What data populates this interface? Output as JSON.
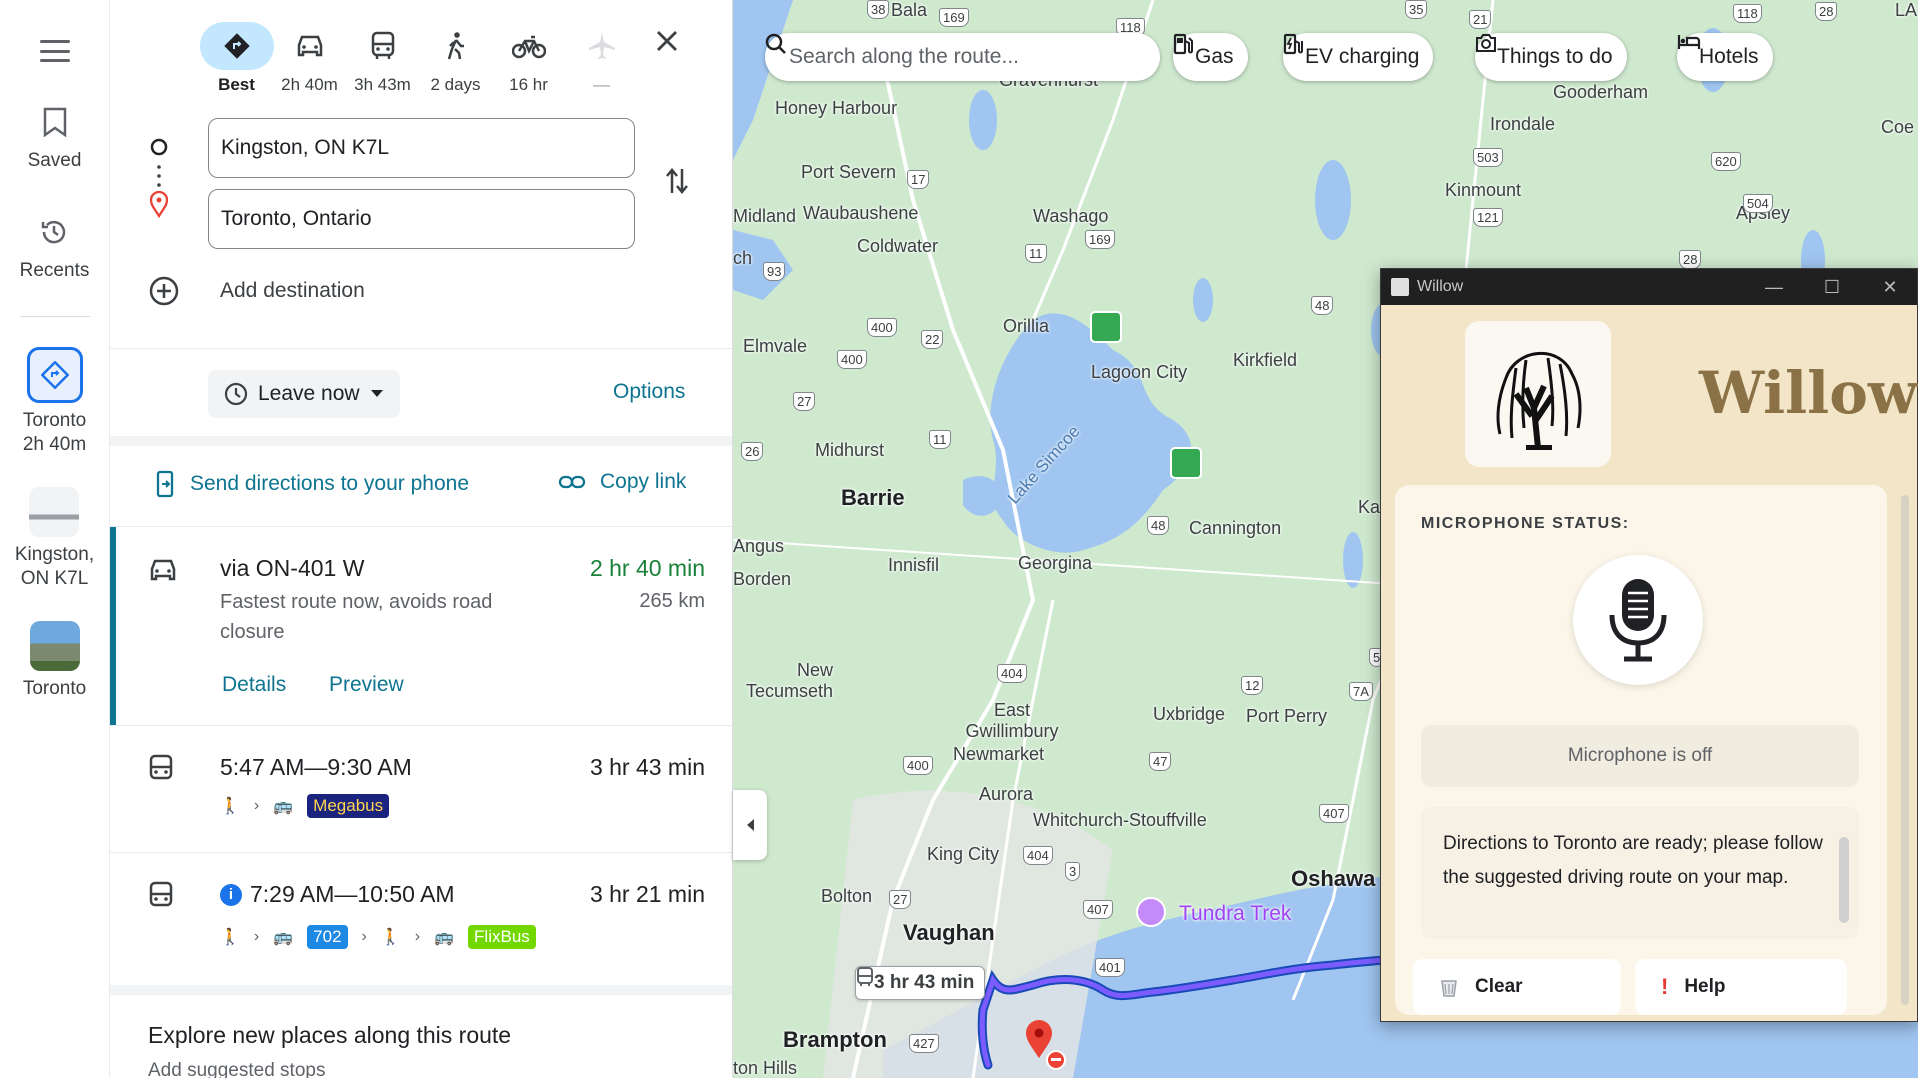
{
  "rail": {
    "saved": "Saved",
    "recents": "Recents",
    "recent_items": [
      {
        "label_line1": "Toronto",
        "label_line2": "2h 40m"
      },
      {
        "label_line1": "Kingston,",
        "label_line2": "ON K7L"
      },
      {
        "label_line1": "Toronto",
        "label_line2": ""
      }
    ]
  },
  "modes": [
    {
      "label": "Best"
    },
    {
      "label": "2h 40m"
    },
    {
      "label": "3h 43m"
    },
    {
      "label": "2 days"
    },
    {
      "label": "16 hr"
    },
    {
      "label": "—"
    }
  ],
  "origin": "Kingston, ON K7L",
  "destination": "Toronto, Ontario",
  "add_destination": "Add destination",
  "leave_now": "Leave now",
  "options": "Options",
  "send_directions": "Send directions to your phone",
  "copy_link": "Copy link",
  "routes": {
    "drive": {
      "title": "via ON-401 W",
      "time": "2 hr 40 min",
      "subtitle": "Fastest route now, avoids road closure",
      "distance": "265 km",
      "details": "Details",
      "preview": "Preview"
    },
    "transit1": {
      "title": "5:47 AM—9:30 AM",
      "time": "3 hr 43 min",
      "badge": "Megabus"
    },
    "transit2": {
      "info": "i",
      "title": "7:29 AM—10:50 AM",
      "time": "3 hr 21 min",
      "badge1": "702",
      "badge2": "FlixBus"
    }
  },
  "explore": {
    "title": "Explore new places along this route",
    "subtitle": "Add suggested stops"
  },
  "map": {
    "search_placeholder": "Search along the route...",
    "chips": [
      "Gas",
      "EV charging",
      "Things to do",
      "Hotels"
    ],
    "route_bubble": "3 hr 43 min",
    "labels": {
      "bala": "Bala",
      "honey_harbour": "Honey Harbour",
      "gravenhurst": "Gravenhurst",
      "gooderham": "Gooderham",
      "irondale": "Irondale",
      "coe_hill": "Coe H",
      "port_severn": "Port Severn",
      "midland": "Midland",
      "waubaushene": "Waubaushene",
      "coldwater": "Coldwater",
      "washago": "Washago",
      "kinmount": "Kinmount",
      "apsley": "Apsley",
      "elmvale": "Elmvale",
      "orillia": "Orillia",
      "lagoon_city": "Lagoon City",
      "kirkfield": "Kirkfield",
      "midhurst": "Midhurst",
      "barrie": "Barrie",
      "lake_simcoe": "Lake Simcoe",
      "cannington": "Cannington",
      "angus": "Angus",
      "borden": "Borden",
      "innisfil": "Innisfil",
      "georgina": "Georgina",
      "new_tecumseth": "New Tecumseth",
      "east_gwillimbury": "East Gwillimbury",
      "newmarket": "Newmarket",
      "uxbridge": "Uxbridge",
      "port_perry": "Port Perry",
      "aurora": "Aurora",
      "whitchurch": "Whitchurch-Stouffville",
      "king_city": "King City",
      "oshawa": "Oshawa",
      "bolton": "Bolton",
      "tundra_trek": "Tundra Trek",
      "vaughan": "Vaughan",
      "brampton": "Brampton",
      "hills": "ton Hills",
      "ch": "ch",
      "ka": "Ka",
      "la": "LA"
    },
    "shields": [
      "38",
      "169",
      "118",
      "35",
      "21",
      "118",
      "28",
      "503",
      "620",
      "17",
      "121",
      "504",
      "169",
      "93",
      "11",
      "28",
      "48",
      "400",
      "22",
      "400",
      "27",
      "26",
      "11",
      "48",
      "404",
      "12",
      "7A",
      "5",
      "400",
      "47",
      "407",
      "404",
      "3",
      "27",
      "407",
      "401",
      "427"
    ]
  },
  "willow": {
    "window_title": "Willow",
    "brand": "Willow",
    "mic_status_label": "MICROPHONE STATUS:",
    "mic_off": "Microphone is off",
    "message": "Directions to Toronto are ready; please follow the suggested driving route on your map.",
    "clear": "Clear",
    "help": "Help"
  }
}
